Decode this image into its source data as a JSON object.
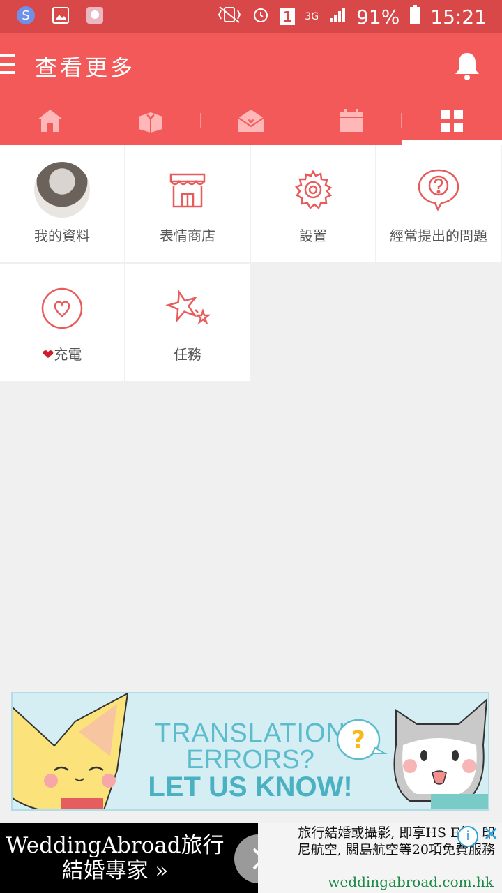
{
  "status_bar": {
    "battery": "91%",
    "time": "15:21",
    "sim": "1",
    "network": "3G"
  },
  "app_bar": {
    "title": "查看更多"
  },
  "tabs": [
    "home",
    "gift",
    "mail",
    "calendar",
    "more"
  ],
  "grid": [
    {
      "label": "我的資料"
    },
    {
      "label": "表情商店"
    },
    {
      "label": "設置"
    },
    {
      "label": "經常提出的問題"
    },
    {
      "label": "充電",
      "prefix": "❤"
    },
    {
      "label": "任務"
    }
  ],
  "banner": {
    "line1": "TRANSLATION",
    "line2": "ERRORS?",
    "line3": "LET US KNOW!"
  },
  "ad": {
    "left_line1": "WeddingAbroad旅行",
    "left_line2": "結婚專家 »",
    "right_text": "旅行結婚或攝影, 即享HS E打, 印尼航空, 關島航空等20項免費服務",
    "domain": "weddingabroad.com.hk"
  },
  "colors": {
    "primary": "#f45959",
    "status": "#d94848",
    "icon": "#e85b5b"
  }
}
